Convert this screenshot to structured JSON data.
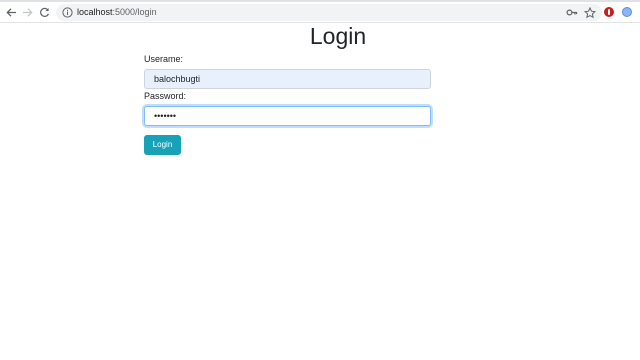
{
  "browser": {
    "url_host": "localhost",
    "url_path": ":5000/login"
  },
  "page": {
    "title": "Login",
    "username_label": "Userame:",
    "username_value": "balochbugti",
    "password_label": "Password:",
    "password_value": "•••••••",
    "login_button": "Login"
  },
  "colors": {
    "button": "#17a2b8",
    "autofill": "#e8f0fe",
    "focus_border": "#80bdff"
  }
}
